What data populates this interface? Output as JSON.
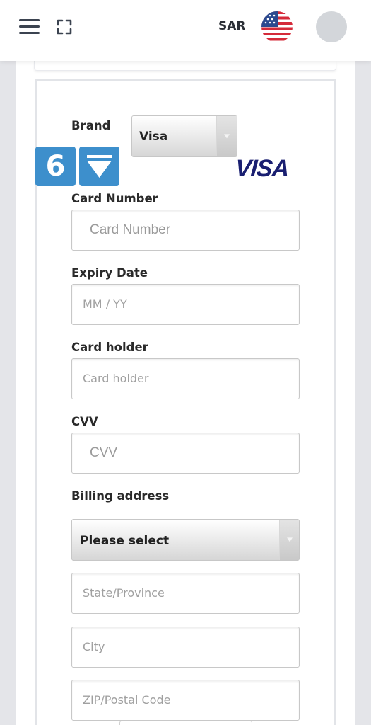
{
  "header": {
    "currency": "SAR",
    "icons": {
      "menu": "menu-icon",
      "fullscreen": "fullscreen-icon",
      "language_flag": "us-flag-icon",
      "avatar": "avatar-icon"
    }
  },
  "colors": {
    "badge_bg": "#3d8fcc",
    "visa_blue": "#1a1f71",
    "page_bg": "#e4e5e9"
  },
  "form": {
    "brand": {
      "label": "Brand",
      "selected": "Visa",
      "logo_text": "VISA"
    },
    "step_badge": {
      "number": "6",
      "icon": "arrow-down-icon"
    },
    "card_number": {
      "label": "Card Number",
      "placeholder": "Card Number"
    },
    "expiry": {
      "label": "Expiry Date",
      "placeholder": "MM / YY"
    },
    "card_holder": {
      "label": "Card holder",
      "placeholder": "Card holder"
    },
    "cvv": {
      "label": "CVV",
      "placeholder": "CVV"
    },
    "billing": {
      "label": "Billing address",
      "selected": "Please select",
      "state_placeholder": "State/Province",
      "city_placeholder": "City",
      "zip_placeholder": "ZIP/Postal Code"
    }
  }
}
